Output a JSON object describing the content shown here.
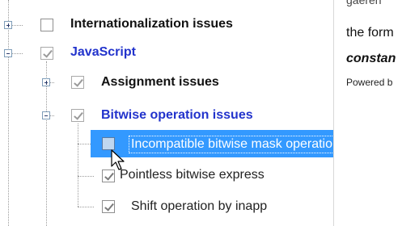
{
  "tree": {
    "items": [
      {
        "label": "Internationalization issues",
        "checked": false,
        "expanded": false
      },
      {
        "label": "JavaScript",
        "checked": true,
        "expanded": true,
        "highlighted": true
      },
      {
        "label": "Assignment issues",
        "checked": true,
        "expanded": false
      },
      {
        "label": "Bitwise operation issues",
        "checked": true,
        "expanded": true,
        "highlighted": true
      },
      {
        "label": "Incompatible bitwise mask operation",
        "checked": false,
        "selected": true
      },
      {
        "label": "Pointless bitwise express",
        "checked": true
      },
      {
        "label": "Shift operation by inapp",
        "checked": true
      }
    ]
  },
  "description": {
    "partial_line": "gaeren",
    "line1": "the form",
    "line2": "constan",
    "powered": "Powered b"
  },
  "colors": {
    "selection": "#3399ff",
    "highlight_text": "#2233cc"
  }
}
